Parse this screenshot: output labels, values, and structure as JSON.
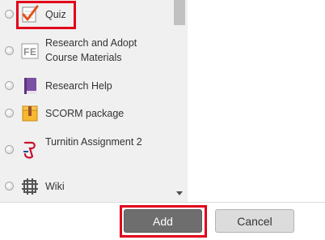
{
  "activities": [
    {
      "label": "Quiz",
      "icon": "quiz-checkmark-icon",
      "selected": false,
      "highlighted": true
    },
    {
      "label": "Research and Adopt Course Materials",
      "icon": "course-materials-icon",
      "selected": false
    },
    {
      "label": "Research Help",
      "icon": "book-icon",
      "selected": false
    },
    {
      "label": "SCORM package",
      "icon": "scorm-package-icon",
      "selected": false
    },
    {
      "label": "Turnitin Assignment 2",
      "icon": "turnitin-icon",
      "selected": false
    },
    {
      "label": "Wiki",
      "icon": "wiki-icon",
      "selected": false
    }
  ],
  "buttons": {
    "add_label": "Add",
    "cancel_label": "Cancel"
  },
  "colors": {
    "highlight": "#e1001a",
    "list_background": "#f0f0f0",
    "add_button": "#6e6e6e",
    "cancel_button": "#dcdcdc"
  }
}
